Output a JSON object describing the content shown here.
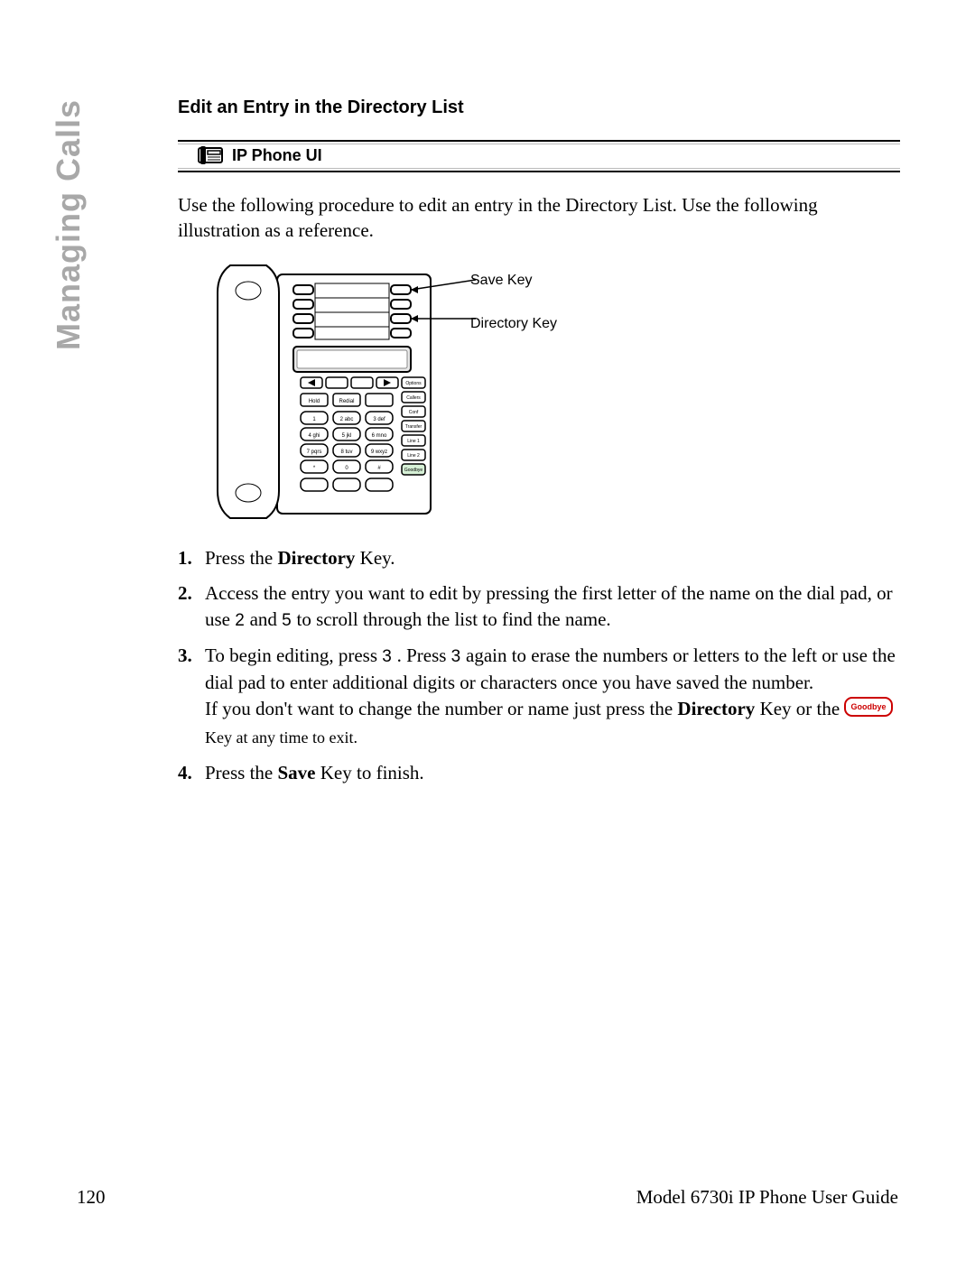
{
  "side_tab": "Managing Calls",
  "heading": "Edit an Entry in the Directory List",
  "sub_heading": "IP Phone UI",
  "intro": "Use the following procedure to edit an entry in the Directory List. Use the following illustration as a reference.",
  "illustration": {
    "callout_save": "Save Key",
    "callout_directory": "Directory Key",
    "func_keys": [
      "Options",
      "Callers",
      "Conf",
      "Transfer",
      "Line 1",
      "Line 2",
      "Goodbye"
    ],
    "action_keys": [
      "Hold",
      "Redial",
      ""
    ],
    "dial_rows": [
      [
        "1",
        "2 abc",
        "3 def"
      ],
      [
        "4 ghi",
        "5 jkl",
        "6 mno"
      ],
      [
        "7 pqrs",
        "8 tuv",
        "9 wxyz"
      ],
      [
        "*",
        "0",
        "#"
      ]
    ]
  },
  "goodbye_label": "Goodbye",
  "steps": {
    "s1_a": "Press the ",
    "s1_b": "Directory",
    "s1_c": " Key.",
    "s2_a": "Access the entry you want to edit by pressing the first letter of the name on the dial pad, or use ",
    "s2_k1": "2",
    "s2_b": " and ",
    "s2_k2": "5",
    "s2_c": " to scroll through the list to find the name.",
    "s3_a": "To begin editing, press ",
    "s3_k1": "3",
    "s3_b": " . Press ",
    "s3_k2": "3",
    "s3_c": " again to erase the numbers or letters to the left or use the dial pad to enter additional digits or characters once you have saved the number.",
    "s3_d": "If you don't want to change the number or name just press the ",
    "s3_e": "Directory",
    "s3_f": " Key or the ",
    "s3_g": " Key at any time to exit.",
    "s4_a": "Press the ",
    "s4_b": "Save",
    "s4_c": " Key to finish."
  },
  "footer": {
    "page_num": "120",
    "guide": "Model 6730i IP Phone User Guide"
  }
}
